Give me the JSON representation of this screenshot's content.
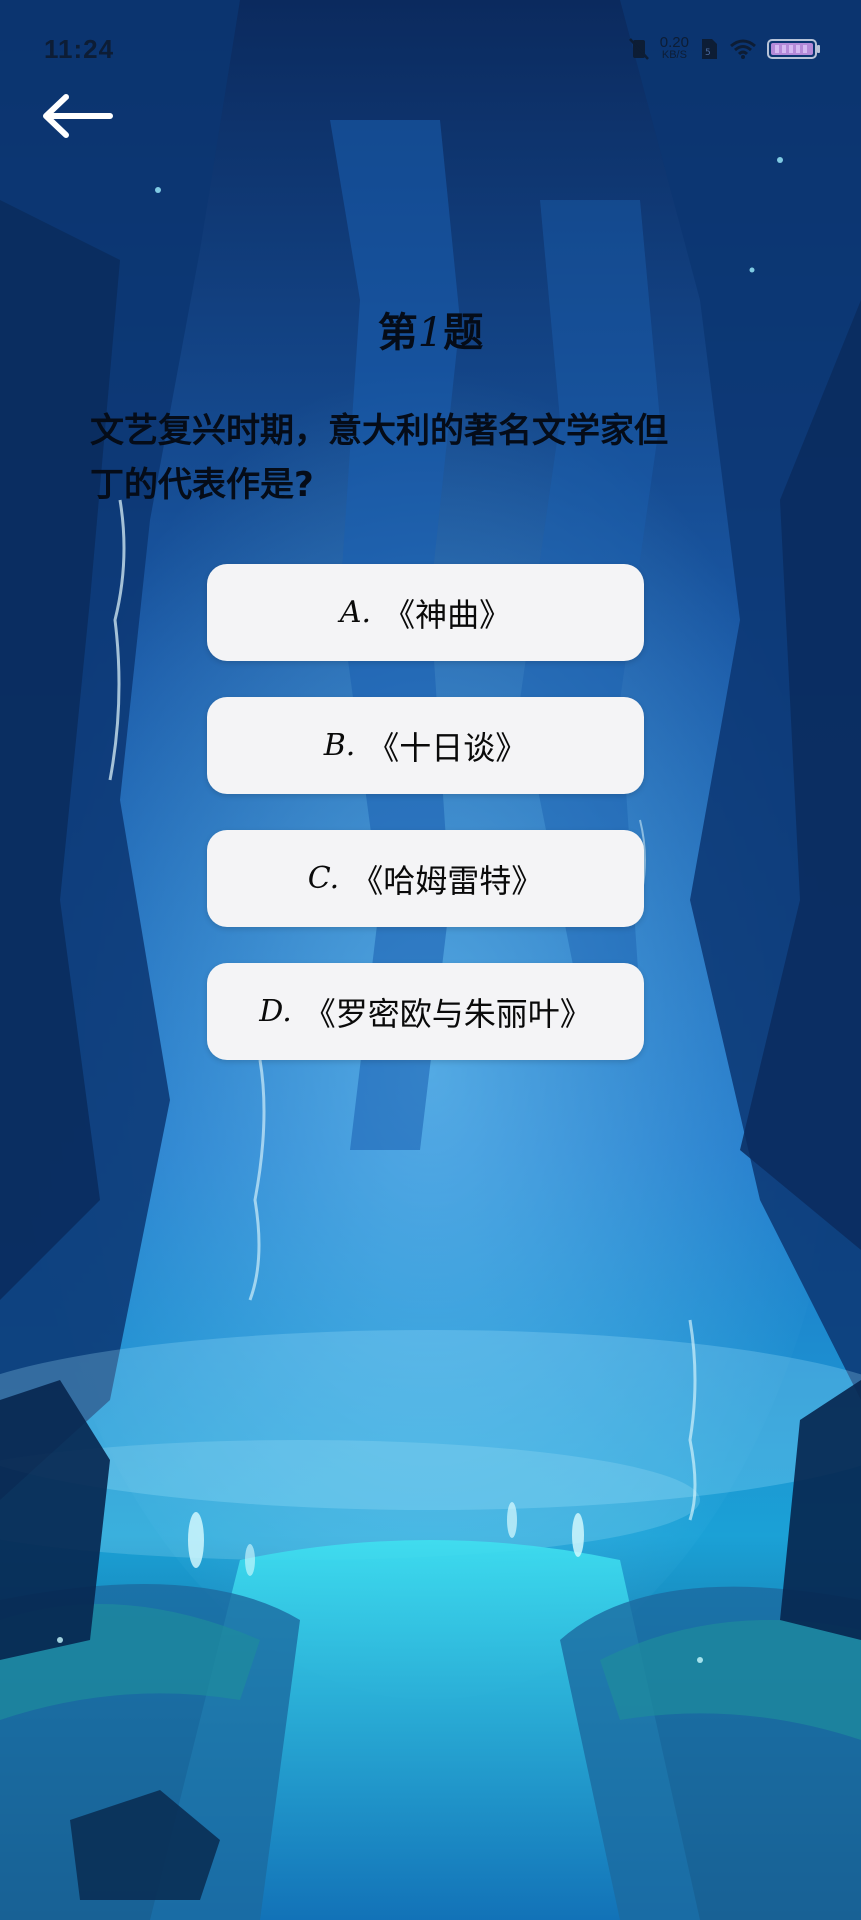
{
  "status_bar": {
    "time": "11:24",
    "net_speed_value": "0.20",
    "net_speed_unit": "KB/S"
  },
  "nav": {
    "back_icon": "arrow-left-icon"
  },
  "quiz": {
    "question_prefix": "第",
    "question_number": "1",
    "question_suffix": "题",
    "question_text_line1": "文艺复兴时期，意大利的著名文学家但",
    "question_text_line2": "丁的代表作是?",
    "options": [
      {
        "letter": "A.",
        "text": "《神曲》"
      },
      {
        "letter": "B.",
        "text": "《十日谈》"
      },
      {
        "letter": "C.",
        "text": "《哈姆雷特》"
      },
      {
        "letter": "D.",
        "text": "《罗密欧与朱丽叶》"
      }
    ]
  },
  "colors": {
    "background_top": "#0b2f6b",
    "background_mid": "#1b6fc0",
    "background_glow": "#2fd2e6",
    "option_bg": "#f4f4f6",
    "text_dark": "#050c18"
  }
}
